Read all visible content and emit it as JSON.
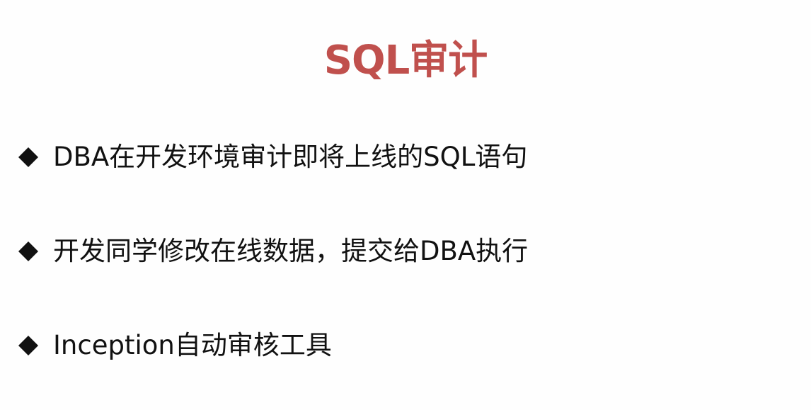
{
  "title": "SQL审计",
  "colors": {
    "title": "#c0504d",
    "text": "#111111",
    "bullet": "#111111"
  },
  "bullets": [
    {
      "icon": "diamond-bullet-icon",
      "text": "DBA在开发环境审计即将上线的SQL语句"
    },
    {
      "icon": "diamond-bullet-icon",
      "text": "开发同学修改在线数据，提交给DBA执行"
    },
    {
      "icon": "diamond-bullet-icon",
      "text": "Inception自动审核工具"
    }
  ]
}
